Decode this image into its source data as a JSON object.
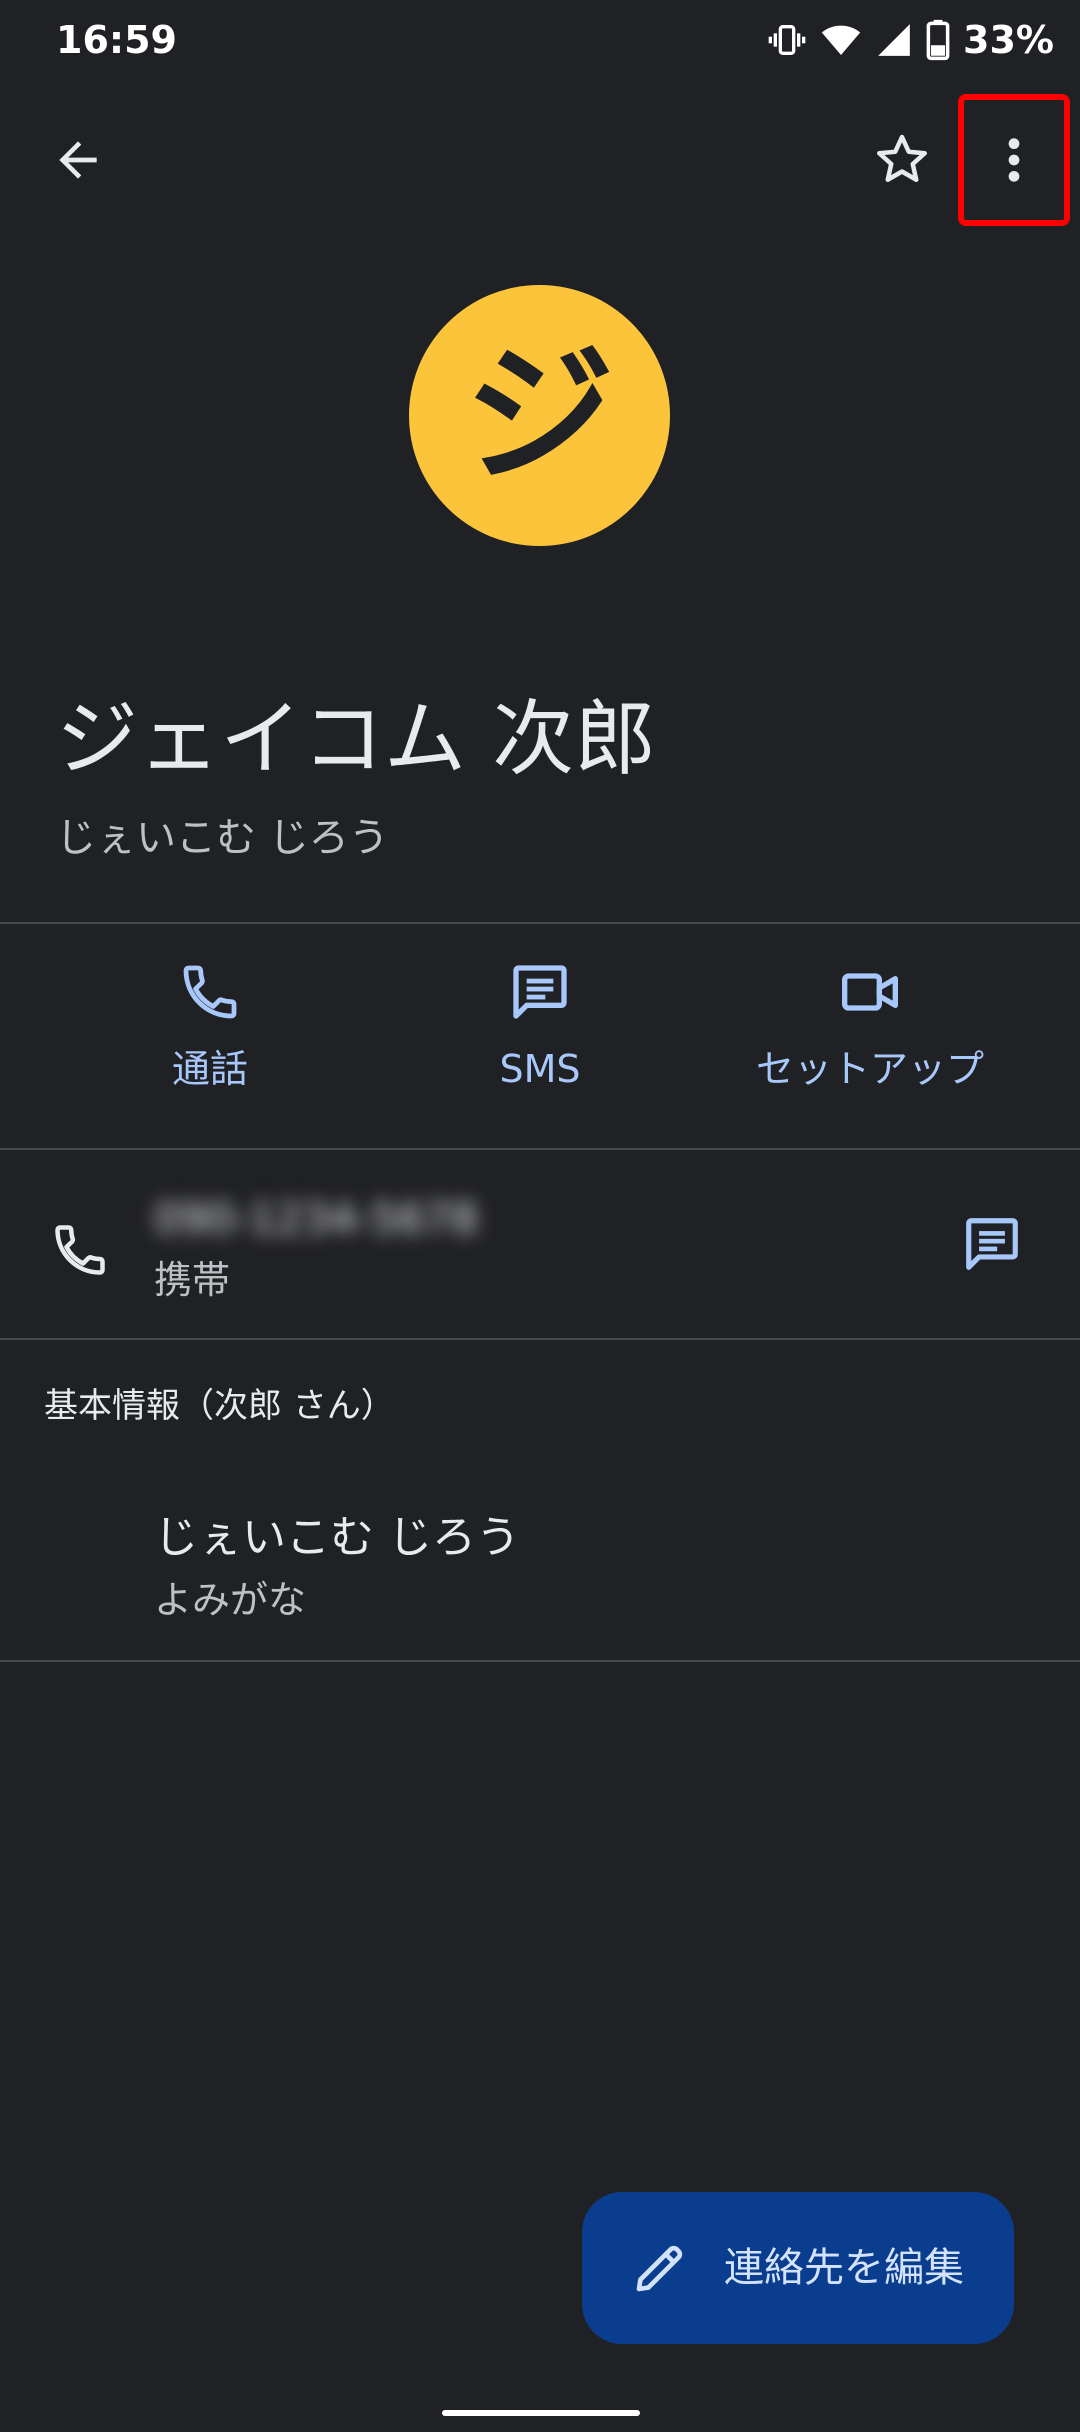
{
  "status_bar": {
    "time": "16:59",
    "battery_percent": "33%",
    "icons": [
      "vibrate-icon",
      "wifi-icon",
      "cell-signal-icon",
      "battery-icon"
    ]
  },
  "app_bar": {
    "icons": [
      "back-arrow-icon",
      "star-outline-icon",
      "more-vert-icon"
    ]
  },
  "contact": {
    "avatar_letter": "ジ",
    "avatar_color": "#fbc43a",
    "name": "ジェイコム 次郎",
    "reading": "じぇいこむ じろう"
  },
  "actions": [
    {
      "label": "通話",
      "icon": "phone-icon"
    },
    {
      "label": "SMS",
      "icon": "message-icon"
    },
    {
      "label": "セットアップ",
      "icon": "videocam-icon"
    }
  ],
  "phone": {
    "number": "090-1234-5678",
    "type": "携帯"
  },
  "basic_info": {
    "title": "基本情報（次郎 さん）",
    "value": "じぇいこむ じろう",
    "label": "よみがな"
  },
  "fab": {
    "label": "連絡先を編集",
    "icon": "pencil-icon"
  },
  "colors": {
    "background": "#202124",
    "accent": "#a8c7fa",
    "fab": "#0b3d8f",
    "highlight": "#ff0000"
  }
}
